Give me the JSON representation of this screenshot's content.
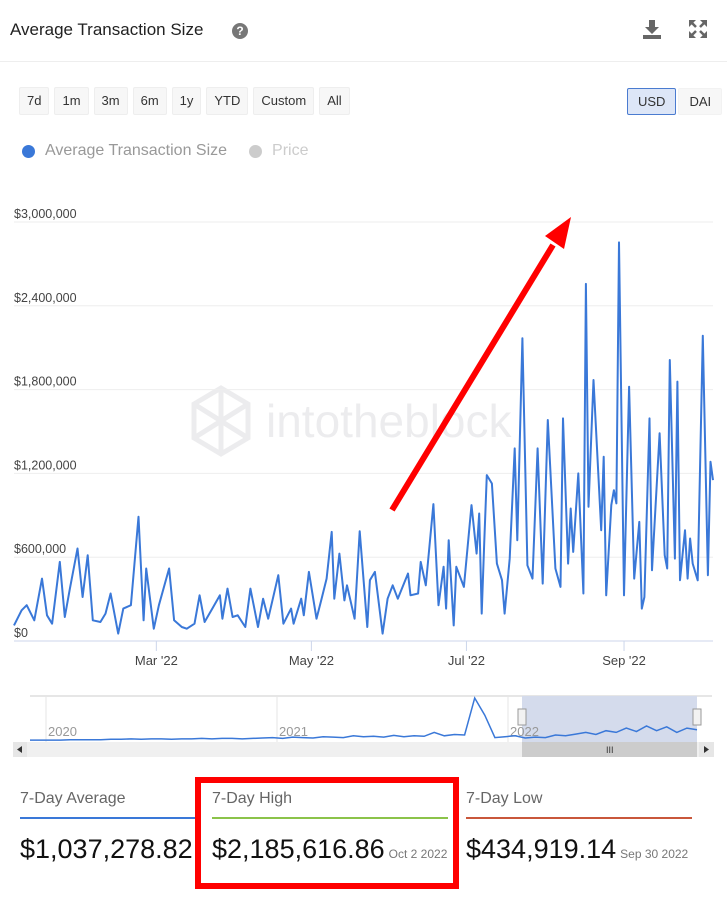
{
  "header": {
    "title": "Average Transaction Size",
    "help_icon": "question-circle-icon",
    "download_icon": "download-icon",
    "expand_icon": "expand-icon"
  },
  "ranges": [
    "7d",
    "1m",
    "3m",
    "6m",
    "1y",
    "YTD",
    "Custom",
    "All"
  ],
  "currency": {
    "options": [
      "USD",
      "DAI"
    ],
    "selected": "USD"
  },
  "legend": [
    {
      "label": "Average Transaction Size",
      "color": "#3a78d8",
      "active": true
    },
    {
      "label": "Price",
      "color": "#cccccc",
      "active": false
    }
  ],
  "watermark": "intotheblock",
  "chart_data": {
    "type": "line",
    "series": [
      {
        "name": "Average Transaction Size",
        "color": "#3a78d8",
        "points": [
          [
            "2022-01-04",
            112000
          ],
          [
            "2022-01-07",
            220000
          ],
          [
            "2022-01-09",
            256000
          ],
          [
            "2022-01-12",
            148000
          ],
          [
            "2022-01-15",
            447000
          ],
          [
            "2022-01-17",
            184000
          ],
          [
            "2022-01-19",
            124000
          ],
          [
            "2022-01-22",
            566000
          ],
          [
            "2022-01-24",
            172000
          ],
          [
            "2022-01-26",
            375000
          ],
          [
            "2022-01-29",
            662000
          ],
          [
            "2022-01-31",
            315000
          ],
          [
            "2022-02-02",
            614000
          ],
          [
            "2022-02-04",
            148000
          ],
          [
            "2022-02-07",
            136000
          ],
          [
            "2022-02-09",
            196000
          ],
          [
            "2022-02-11",
            340000
          ],
          [
            "2022-02-14",
            53000
          ],
          [
            "2022-02-16",
            232000
          ],
          [
            "2022-02-19",
            256000
          ],
          [
            "2022-02-22",
            889000
          ],
          [
            "2022-02-24",
            148000
          ],
          [
            "2022-02-25",
            519000
          ],
          [
            "2022-02-28",
            88000
          ],
          [
            "2022-03-02",
            256000
          ],
          [
            "2022-03-06",
            519000
          ],
          [
            "2022-03-08",
            148000
          ],
          [
            "2022-03-11",
            100000
          ],
          [
            "2022-03-13",
            88000
          ],
          [
            "2022-03-16",
            124000
          ],
          [
            "2022-03-18",
            327000
          ],
          [
            "2022-03-20",
            136000
          ],
          [
            "2022-03-23",
            232000
          ],
          [
            "2022-03-26",
            327000
          ],
          [
            "2022-03-27",
            160000
          ],
          [
            "2022-03-29",
            375000
          ],
          [
            "2022-03-31",
            172000
          ],
          [
            "2022-04-02",
            184000
          ],
          [
            "2022-04-05",
            100000
          ],
          [
            "2022-04-07",
            375000
          ],
          [
            "2022-04-10",
            100000
          ],
          [
            "2022-04-12",
            303000
          ],
          [
            "2022-04-14",
            160000
          ],
          [
            "2022-04-18",
            471000
          ],
          [
            "2022-04-20",
            124000
          ],
          [
            "2022-04-23",
            232000
          ],
          [
            "2022-04-24",
            124000
          ],
          [
            "2022-04-27",
            303000
          ],
          [
            "2022-04-28",
            184000
          ],
          [
            "2022-04-30",
            495000
          ],
          [
            "2022-05-03",
            160000
          ],
          [
            "2022-05-05",
            303000
          ],
          [
            "2022-05-07",
            447000
          ],
          [
            "2022-05-09",
            781000
          ],
          [
            "2022-05-10",
            303000
          ],
          [
            "2022-05-12",
            626000
          ],
          [
            "2022-05-14",
            291000
          ],
          [
            "2022-05-15",
            399000
          ],
          [
            "2022-05-18",
            160000
          ],
          [
            "2022-05-20",
            786000
          ],
          [
            "2022-05-23",
            100000
          ],
          [
            "2022-05-24",
            435000
          ],
          [
            "2022-05-26",
            495000
          ],
          [
            "2022-05-29",
            53000
          ],
          [
            "2022-05-31",
            303000
          ],
          [
            "2022-06-02",
            399000
          ],
          [
            "2022-06-04",
            303000
          ],
          [
            "2022-06-08",
            483000
          ],
          [
            "2022-06-09",
            327000
          ],
          [
            "2022-06-12",
            340000
          ],
          [
            "2022-06-13",
            566000
          ],
          [
            "2022-06-15",
            399000
          ],
          [
            "2022-06-18",
            980000
          ],
          [
            "2022-06-20",
            256000
          ],
          [
            "2022-06-22",
            531000
          ],
          [
            "2022-06-23",
            232000
          ],
          [
            "2022-06-24",
            722000
          ],
          [
            "2022-06-26",
            112000
          ],
          [
            "2022-06-27",
            531000
          ],
          [
            "2022-06-30",
            387000
          ],
          [
            "2022-07-03",
            973000
          ],
          [
            "2022-07-05",
            626000
          ],
          [
            "2022-07-06",
            913000
          ],
          [
            "2022-07-07",
            196000
          ],
          [
            "2022-07-08",
            698000
          ],
          [
            "2022-07-09",
            1188000
          ],
          [
            "2022-07-11",
            1128000
          ],
          [
            "2022-07-13",
            554000
          ],
          [
            "2022-07-15",
            435000
          ],
          [
            "2022-07-16",
            196000
          ],
          [
            "2022-07-18",
            590000
          ],
          [
            "2022-07-20",
            1379000
          ],
          [
            "2022-07-21",
            722000
          ],
          [
            "2022-07-23",
            2168000
          ],
          [
            "2022-07-25",
            542000
          ],
          [
            "2022-07-27",
            447000
          ],
          [
            "2022-07-29",
            1379000
          ],
          [
            "2022-07-31",
            411000
          ],
          [
            "2022-08-02",
            1582000
          ],
          [
            "2022-08-05",
            519000
          ],
          [
            "2022-08-07",
            387000
          ],
          [
            "2022-08-08",
            1594000
          ],
          [
            "2022-08-10",
            554000
          ],
          [
            "2022-08-11",
            949000
          ],
          [
            "2022-08-12",
            638000
          ],
          [
            "2022-08-14",
            1200000
          ],
          [
            "2022-08-16",
            340000
          ],
          [
            "2022-08-17",
            2557000
          ],
          [
            "2022-08-18",
            961000
          ],
          [
            "2022-08-20",
            1869000
          ],
          [
            "2022-08-23",
            793000
          ],
          [
            "2022-08-24",
            1319000
          ],
          [
            "2022-08-25",
            327000
          ],
          [
            "2022-08-27",
            973000
          ],
          [
            "2022-08-28",
            1080000
          ],
          [
            "2022-08-29",
            985000
          ],
          [
            "2022-08-30",
            2854000
          ],
          [
            "2022-09-01",
            327000
          ],
          [
            "2022-09-03",
            1821000
          ],
          [
            "2022-09-05",
            447000
          ],
          [
            "2022-09-07",
            853000
          ],
          [
            "2022-09-08",
            232000
          ],
          [
            "2022-09-09",
            315000
          ],
          [
            "2022-09-11",
            1594000
          ],
          [
            "2022-09-12",
            507000
          ],
          [
            "2022-09-15",
            1487000
          ],
          [
            "2022-09-17",
            614000
          ],
          [
            "2022-09-18",
            519000
          ],
          [
            "2022-09-19",
            2012000
          ],
          [
            "2022-09-21",
            590000
          ],
          [
            "2022-09-22",
            1857000
          ],
          [
            "2022-09-23",
            435000
          ],
          [
            "2022-09-25",
            793000
          ],
          [
            "2022-09-26",
            447000
          ],
          [
            "2022-09-27",
            734000
          ],
          [
            "2022-09-28",
            554000
          ],
          [
            "2022-09-30",
            434919
          ],
          [
            "2022-10-02",
            2185617
          ],
          [
            "2022-10-04",
            471000
          ],
          [
            "2022-10-05",
            1283000
          ],
          [
            "2022-10-06",
            1152000
          ]
        ]
      }
    ],
    "ylim": [
      0,
      3000000
    ],
    "yticks": [
      {
        "value": 0,
        "label": "$0"
      },
      {
        "value": 600000,
        "label": "$600,000"
      },
      {
        "value": 1200000,
        "label": "$1,200,000"
      },
      {
        "value": 1800000,
        "label": "$1,800,000"
      },
      {
        "value": 2400000,
        "label": "$2,400,000"
      },
      {
        "value": 3000000,
        "label": "$3,000,000"
      }
    ],
    "xticks": [
      {
        "value": "2022-03-01",
        "label": "Mar '22"
      },
      {
        "value": "2022-05-01",
        "label": "May '22"
      },
      {
        "value": "2022-07-01",
        "label": "Jul '22"
      },
      {
        "value": "2022-09-01",
        "label": "Sep '22"
      }
    ],
    "xlim": [
      "2022-01-04",
      "2022-10-06"
    ],
    "grid": true
  },
  "navigator": {
    "years": [
      "2020",
      "2021",
      "2022"
    ],
    "values": [
      2,
      2,
      2,
      2,
      3,
      3,
      3,
      3,
      4,
      4,
      5,
      4,
      5,
      5,
      4,
      5,
      5,
      6,
      5,
      6,
      6,
      5,
      6,
      7,
      8,
      6,
      9,
      8,
      7,
      10,
      9,
      8,
      12,
      10,
      11,
      9,
      13,
      10,
      12,
      11,
      20,
      12,
      15,
      14,
      100,
      60,
      8,
      10,
      12,
      7,
      9,
      8,
      14,
      12,
      16,
      20,
      15,
      24,
      20,
      30,
      22,
      35,
      24,
      33,
      20,
      30,
      26
    ],
    "color": "#3a78d8"
  },
  "stats": [
    {
      "label": "7-Day Average",
      "value": "$1,037,278.82",
      "date": "",
      "color": "#3a78d8"
    },
    {
      "label": "7-Day High",
      "value": "$2,185,616.86",
      "date": "Oct 2 2022",
      "color": "#8bc34a"
    },
    {
      "label": "7-Day Low",
      "value": "$434,919.14",
      "date": "Sep 30 2022",
      "color": "#c9573b"
    }
  ],
  "annotations": {
    "arrow_color": "#ff0000",
    "highlight_box_color": "#ff0000"
  }
}
